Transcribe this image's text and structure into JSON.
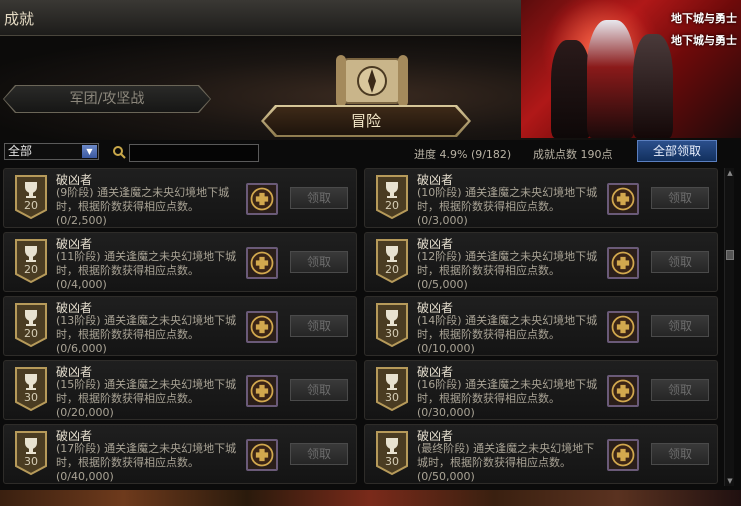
{
  "window": {
    "title": "成就"
  },
  "art": {
    "logo_line1": "地下城与勇士",
    "logo_line2": "地下城与勇士"
  },
  "tabs": [
    {
      "label": "军团/攻坚战",
      "active": false
    },
    {
      "label": "冒险",
      "active": true
    }
  ],
  "filter": {
    "selected": "全部"
  },
  "search": {
    "value": ""
  },
  "summary": {
    "progress_text": "进度  4.9% (9/182)",
    "points_text": "成就点数 190点",
    "claim_all_label": "全部领取"
  },
  "colors": {
    "accent_blue": "#2b4f8c",
    "gold": "#d8c89a",
    "card_bg": "#1a1a1a"
  },
  "achievements": [
    {
      "title": "破凶者",
      "desc": "(9阶段) 通关逢魔之未央幻境地下城时，根据阶数获得相应点数。",
      "progress": "(0/2,500)",
      "points": "20",
      "claim_label": "领取"
    },
    {
      "title": "破凶者",
      "desc": "(10阶段) 通关逢魔之未央幻境地下城时，根据阶数获得相应点数。",
      "progress": "(0/3,000)",
      "points": "20",
      "claim_label": "领取"
    },
    {
      "title": "破凶者",
      "desc": "(11阶段) 通关逢魔之未央幻境地下城时，根据阶数获得相应点数。",
      "progress": "(0/4,000)",
      "points": "20",
      "claim_label": "领取"
    },
    {
      "title": "破凶者",
      "desc": "(12阶段) 通关逢魔之未央幻境地下城时，根据阶数获得相应点数。",
      "progress": "(0/5,000)",
      "points": "20",
      "claim_label": "领取"
    },
    {
      "title": "破凶者",
      "desc": "(13阶段) 通关逢魔之未央幻境地下城时，根据阶数获得相应点数。",
      "progress": "(0/6,000)",
      "points": "20",
      "claim_label": "领取"
    },
    {
      "title": "破凶者",
      "desc": "(14阶段) 通关逢魔之未央幻境地下城时，根据阶数获得相应点数。",
      "progress": "(0/10,000)",
      "points": "30",
      "claim_label": "领取"
    },
    {
      "title": "破凶者",
      "desc": "(15阶段) 通关逢魔之未央幻境地下城时，根据阶数获得相应点数。",
      "progress": "(0/20,000)",
      "points": "30",
      "claim_label": "领取"
    },
    {
      "title": "破凶者",
      "desc": "(16阶段) 通关逢魔之未央幻境地下城时，根据阶数获得相应点数。",
      "progress": "(0/30,000)",
      "points": "30",
      "claim_label": "领取"
    },
    {
      "title": "破凶者",
      "desc": "(17阶段) 通关逢魔之未央幻境地下城时，根据阶数获得相应点数。",
      "progress": "(0/40,000)",
      "points": "30",
      "claim_label": "领取"
    },
    {
      "title": "破凶者",
      "desc": "(最终阶段) 通关逢魔之未央幻境地下城时，根据阶数获得相应点数。",
      "progress": "(0/50,000)",
      "points": "30",
      "claim_label": "领取"
    }
  ]
}
